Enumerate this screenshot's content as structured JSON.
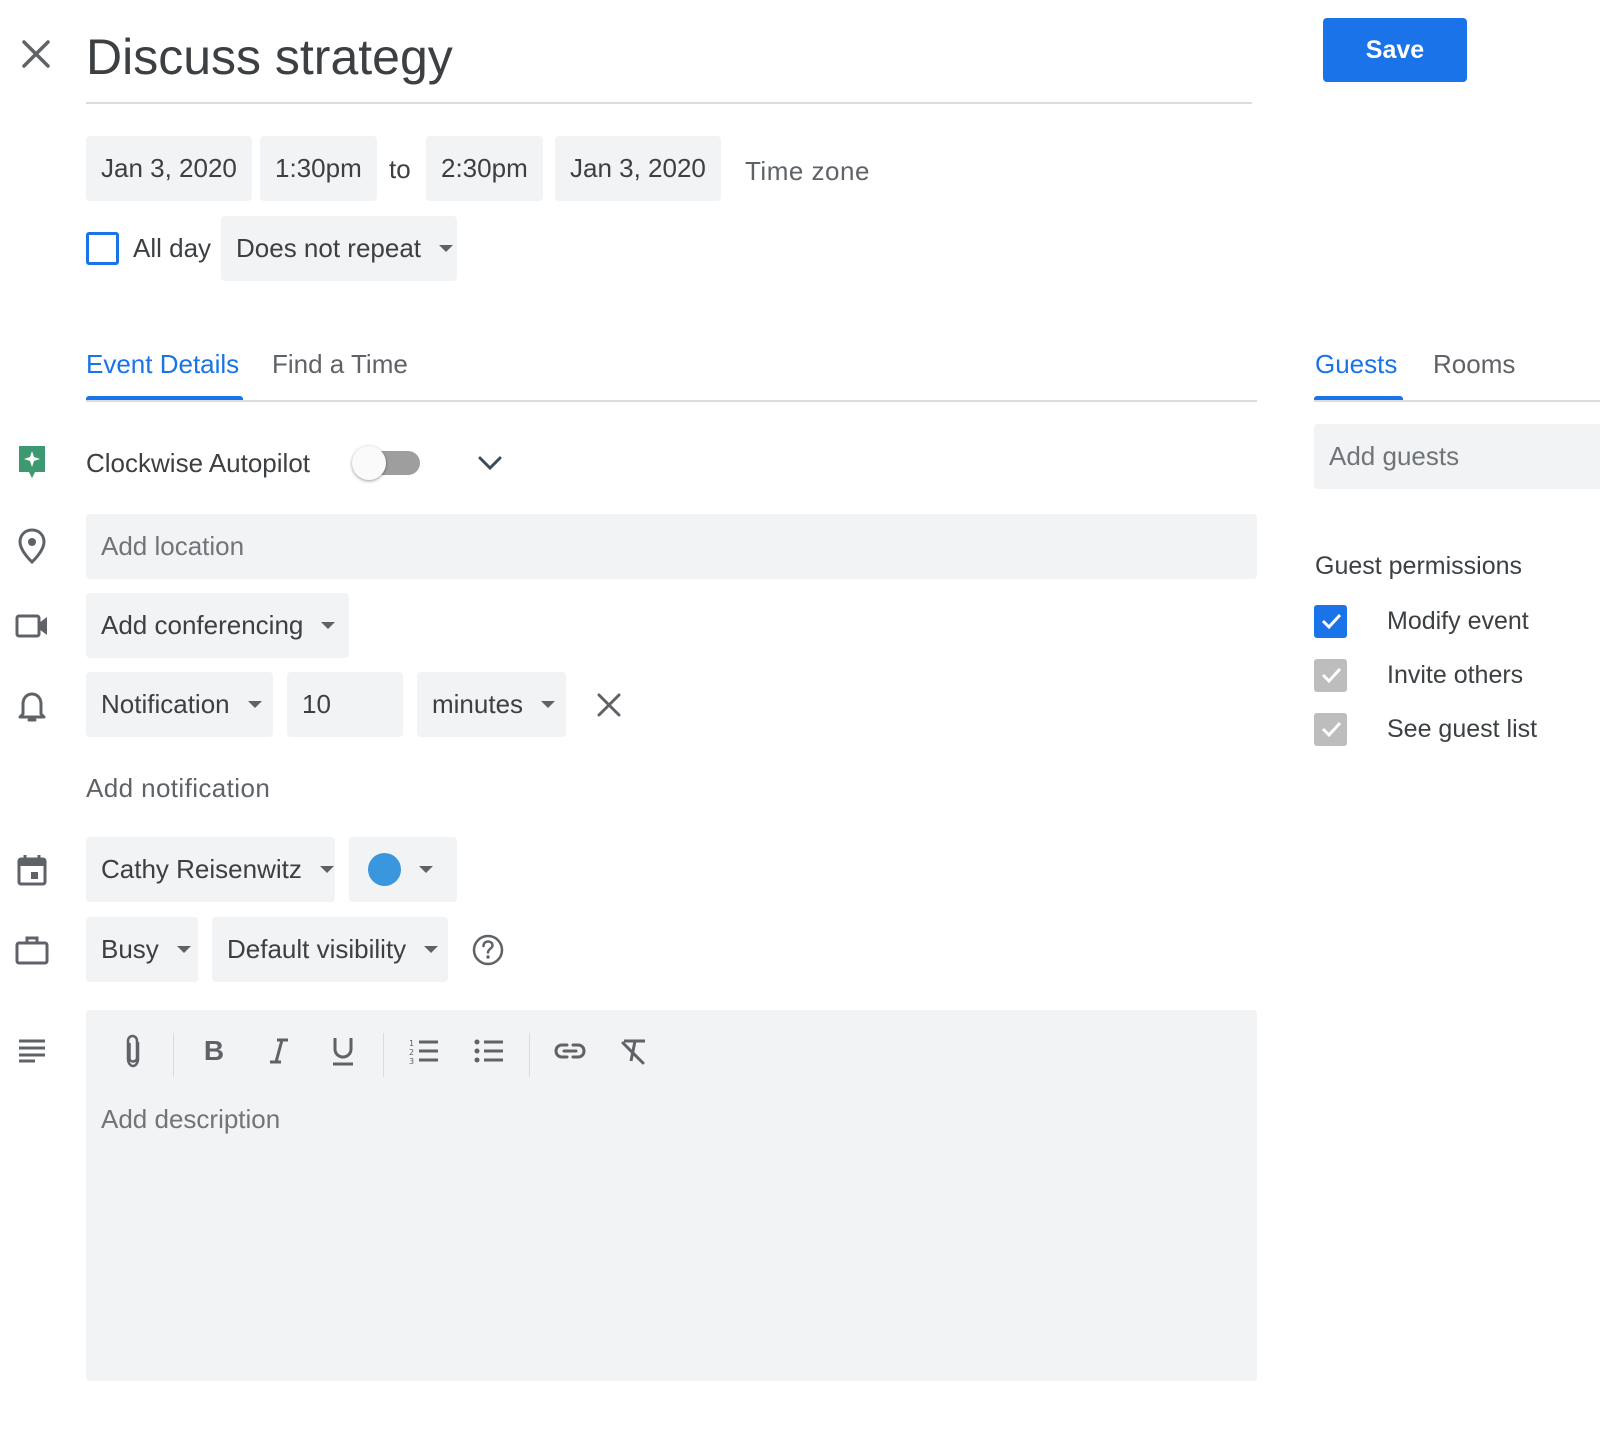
{
  "header": {
    "title": "Discuss strategy",
    "save_label": "Save"
  },
  "datetime": {
    "start_date": "Jan 3, 2020",
    "start_time": "1:30pm",
    "separator": "to",
    "end_time": "2:30pm",
    "end_date": "Jan 3, 2020",
    "time_zone_label": "Time zone",
    "all_day_label": "All day",
    "all_day_checked": false,
    "repeat_value": "Does not repeat"
  },
  "tabs": {
    "left": [
      {
        "label": "Event Details",
        "active": true
      },
      {
        "label": "Find a Time",
        "active": false
      }
    ],
    "right": [
      {
        "label": "Guests",
        "active": true
      },
      {
        "label": "Rooms",
        "active": false
      }
    ]
  },
  "details": {
    "clockwise_label": "Clockwise Autopilot",
    "clockwise_enabled": false,
    "location_placeholder": "Add location",
    "conferencing_label": "Add conferencing",
    "notification": {
      "type": "Notification",
      "amount": "10",
      "unit": "minutes"
    },
    "add_notification_label": "Add notification",
    "calendar_owner": "Cathy Reisenwitz",
    "event_color": "#3a96dd",
    "availability": "Busy",
    "visibility": "Default visibility",
    "description_placeholder": "Add description"
  },
  "guests": {
    "add_guests_placeholder": "Add guests",
    "permissions_title": "Guest permissions",
    "permissions": [
      {
        "label": "Modify event",
        "checked": true,
        "enabled": true
      },
      {
        "label": "Invite others",
        "checked": true,
        "enabled": false
      },
      {
        "label": "See guest list",
        "checked": true,
        "enabled": false
      }
    ]
  },
  "colors": {
    "accent": "#1a73e8",
    "field_bg": "#f1f3f4",
    "clockwise_green": "#3d9970",
    "disabled_check": "#bdbdbd"
  },
  "icons": {
    "close": "close-icon",
    "clockwise": "clockwise-icon",
    "location": "location-pin-icon",
    "video": "video-camera-icon",
    "bell": "bell-icon",
    "calendar": "calendar-icon",
    "briefcase": "briefcase-icon",
    "description": "description-lines-icon",
    "help": "help-circle-icon"
  }
}
